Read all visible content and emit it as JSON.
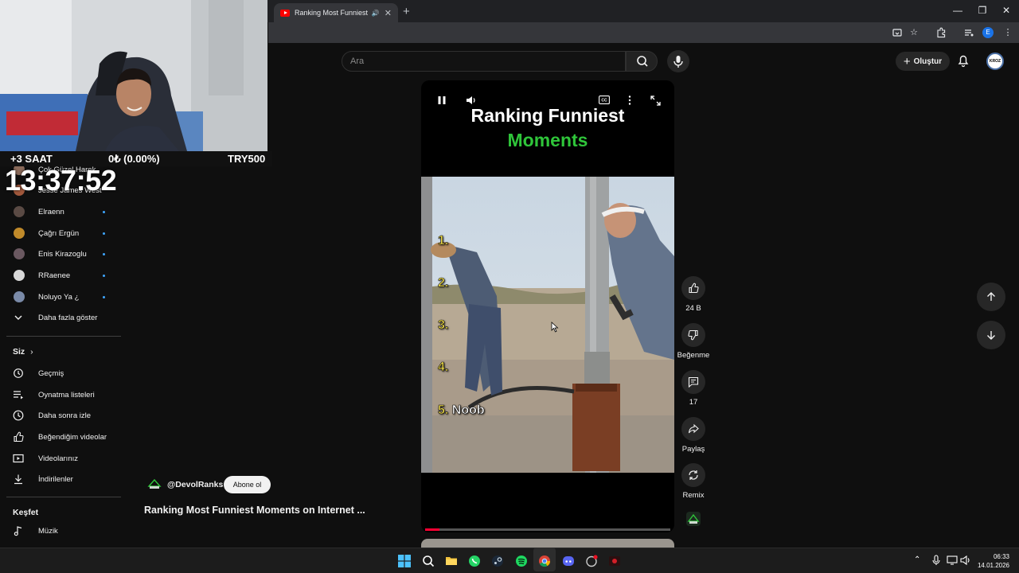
{
  "browser": {
    "tab_title": "Ranking Most Funniest Mo",
    "tab_close": "✕",
    "new_tab": "+",
    "profile_initial": "E",
    "window_minimize": "—",
    "window_restore": "❐",
    "window_close": "✕"
  },
  "youtube": {
    "search_placeholder": "Ara",
    "create_label": "Oluştur",
    "avatar_text": "KROZ"
  },
  "sidebar": {
    "subscriptions": [
      {
        "label": "Çok Güzel Harek",
        "color": "#8a6a5a"
      },
      {
        "label": "Jesse James West",
        "color": "#a0583c"
      },
      {
        "label": "Elraenn",
        "color": "#5a4a44"
      },
      {
        "label": "Çağrı Ergün",
        "color": "#c08a2a"
      },
      {
        "label": "Enis Kirazoglu",
        "color": "#6a5860"
      },
      {
        "label": "RRaenee",
        "color": "#d8d8d8"
      },
      {
        "label": "Noluyo Ya ¿",
        "color": "#7a8aa8"
      }
    ],
    "show_more": "Daha fazla göster",
    "you_header": "Siz",
    "you_chevron": "›",
    "you_items": [
      {
        "label": "Geçmiş",
        "icon": "history-icon"
      },
      {
        "label": "Oynatma listeleri",
        "icon": "playlist-icon"
      },
      {
        "label": "Daha sonra izle",
        "icon": "clock-icon"
      },
      {
        "label": "Beğendiğim videolar",
        "icon": "like-icon"
      },
      {
        "label": "Videolarınız",
        "icon": "your-videos-icon"
      },
      {
        "label": "İndirilenler",
        "icon": "download-icon"
      }
    ],
    "explore_header": "Keşfet",
    "explore_items": [
      {
        "label": "Müzik",
        "icon": "music-icon"
      }
    ]
  },
  "overlay": {
    "saat": "+3 SAAT",
    "balance": "0₺ (0.00%)",
    "goal": "TRY500",
    "clock": "13:37:52"
  },
  "short": {
    "title_line1": "Ranking Funniest",
    "title_line2": "Moments",
    "ranks": [
      "1.",
      "2.",
      "3.",
      "4.",
      "5."
    ],
    "rank5_text": "Noob",
    "progress": 0.06,
    "channel": "@DevolRanks",
    "subscribe_label": "Abone ol",
    "video_title": "Ranking Most Funniest Moments on Internet ..."
  },
  "actions": {
    "likes": "24 B",
    "dislike_label": "Beğenme",
    "comments": "17",
    "share_label": "Paylaş",
    "remix_label": "Remix"
  },
  "taskbar": {
    "time": "06:33",
    "date": "14.01.2026"
  }
}
